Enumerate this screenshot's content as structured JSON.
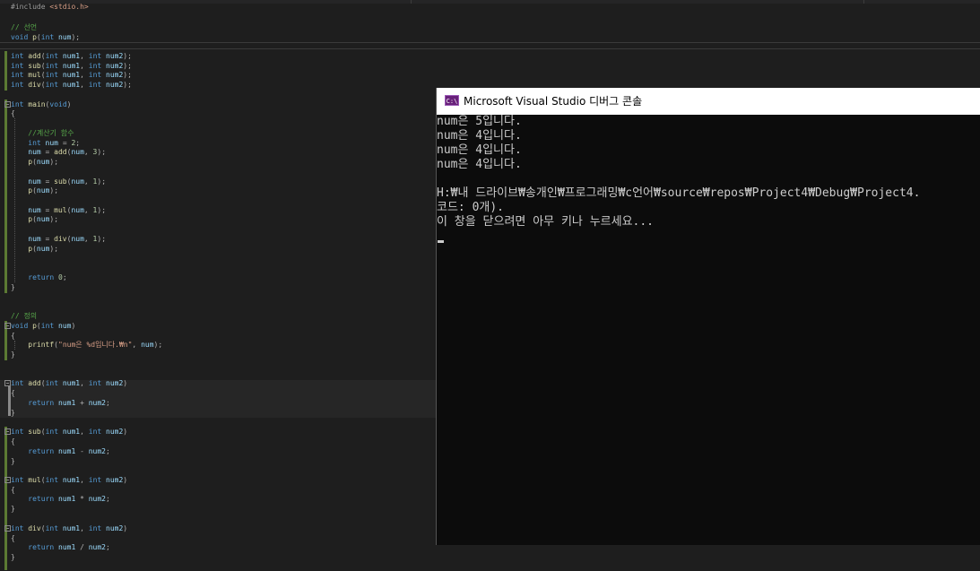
{
  "editor": {
    "lines": [
      {
        "t": 2,
        "tokens": [
          [
            "pp",
            "#include"
          ],
          [
            "pu",
            " "
          ],
          [
            "st",
            "<stdio.h>"
          ]
        ]
      },
      {
        "t": 25,
        "tokens": [
          [
            "cm",
            "// 선언"
          ]
        ]
      },
      {
        "t": 36,
        "tokens": [
          [
            "kw",
            "void"
          ],
          [
            "pu",
            " "
          ],
          [
            "fn",
            "p"
          ],
          [
            "pu",
            "("
          ],
          [
            "kw",
            "int"
          ],
          [
            "pu",
            " "
          ],
          [
            "id",
            "num"
          ],
          [
            "pu",
            ");"
          ]
        ]
      },
      {
        "t": 57,
        "tokens": [
          [
            "kw",
            "int"
          ],
          [
            "pu",
            " "
          ],
          [
            "fn",
            "add"
          ],
          [
            "pu",
            "("
          ],
          [
            "kw",
            "int"
          ],
          [
            "pu",
            " "
          ],
          [
            "id",
            "num1"
          ],
          [
            "pu",
            ", "
          ],
          [
            "kw",
            "int"
          ],
          [
            "pu",
            " "
          ],
          [
            "id",
            "num2"
          ],
          [
            "pu",
            ");"
          ]
        ]
      },
      {
        "t": 68,
        "tokens": [
          [
            "kw",
            "int"
          ],
          [
            "pu",
            " "
          ],
          [
            "fn",
            "sub"
          ],
          [
            "pu",
            "("
          ],
          [
            "kw",
            "int"
          ],
          [
            "pu",
            " "
          ],
          [
            "id",
            "num1"
          ],
          [
            "pu",
            ", "
          ],
          [
            "kw",
            "int"
          ],
          [
            "pu",
            " "
          ],
          [
            "id",
            "num2"
          ],
          [
            "pu",
            ");"
          ]
        ]
      },
      {
        "t": 78,
        "tokens": [
          [
            "kw",
            "int"
          ],
          [
            "pu",
            " "
          ],
          [
            "fn",
            "mul"
          ],
          [
            "pu",
            "("
          ],
          [
            "kw",
            "int"
          ],
          [
            "pu",
            " "
          ],
          [
            "id",
            "num1"
          ],
          [
            "pu",
            ", "
          ],
          [
            "kw",
            "int"
          ],
          [
            "pu",
            " "
          ],
          [
            "id",
            "num2"
          ],
          [
            "pu",
            ");"
          ]
        ]
      },
      {
        "t": 89,
        "tokens": [
          [
            "kw",
            "int"
          ],
          [
            "pu",
            " "
          ],
          [
            "fn",
            "div"
          ],
          [
            "pu",
            "("
          ],
          [
            "kw",
            "int"
          ],
          [
            "pu",
            " "
          ],
          [
            "id",
            "num1"
          ],
          [
            "pu",
            ", "
          ],
          [
            "kw",
            "int"
          ],
          [
            "pu",
            " "
          ],
          [
            "id",
            "num2"
          ],
          [
            "pu",
            ");"
          ]
        ]
      },
      {
        "t": 111,
        "tokens": [
          [
            "kw",
            "int"
          ],
          [
            "pu",
            " "
          ],
          [
            "fn",
            "main"
          ],
          [
            "pu",
            "("
          ],
          [
            "kw",
            "void"
          ],
          [
            "pu",
            ")"
          ]
        ]
      },
      {
        "t": 121,
        "tokens": [
          [
            "pu",
            "{"
          ]
        ]
      },
      {
        "t": 143,
        "tokens": [
          [
            "pu",
            "    "
          ],
          [
            "cm",
            "//계산기 함수"
          ]
        ]
      },
      {
        "t": 154,
        "tokens": [
          [
            "pu",
            "    "
          ],
          [
            "kw",
            "int"
          ],
          [
            "pu",
            " "
          ],
          [
            "id",
            "num"
          ],
          [
            "pu",
            " = "
          ],
          [
            "nm",
            "2"
          ],
          [
            "pu",
            ";"
          ]
        ]
      },
      {
        "t": 164,
        "tokens": [
          [
            "pu",
            "    "
          ],
          [
            "id",
            "num"
          ],
          [
            "pu",
            " = "
          ],
          [
            "fn",
            "add"
          ],
          [
            "pu",
            "("
          ],
          [
            "id",
            "num"
          ],
          [
            "pu",
            ", "
          ],
          [
            "nm",
            "3"
          ],
          [
            "pu",
            ");"
          ]
        ]
      },
      {
        "t": 175,
        "tokens": [
          [
            "pu",
            "    "
          ],
          [
            "fn",
            "p"
          ],
          [
            "pu",
            "("
          ],
          [
            "id",
            "num"
          ],
          [
            "pu",
            ");"
          ]
        ]
      },
      {
        "t": 197,
        "tokens": [
          [
            "pu",
            "    "
          ],
          [
            "id",
            "num"
          ],
          [
            "pu",
            " = "
          ],
          [
            "fn",
            "sub"
          ],
          [
            "pu",
            "("
          ],
          [
            "id",
            "num"
          ],
          [
            "pu",
            ", "
          ],
          [
            "nm",
            "1"
          ],
          [
            "pu",
            ");"
          ]
        ]
      },
      {
        "t": 207,
        "tokens": [
          [
            "pu",
            "    "
          ],
          [
            "fn",
            "p"
          ],
          [
            "pu",
            "("
          ],
          [
            "id",
            "num"
          ],
          [
            "pu",
            ");"
          ]
        ]
      },
      {
        "t": 229,
        "tokens": [
          [
            "pu",
            "    "
          ],
          [
            "id",
            "num"
          ],
          [
            "pu",
            " = "
          ],
          [
            "fn",
            "mul"
          ],
          [
            "pu",
            "("
          ],
          [
            "id",
            "num"
          ],
          [
            "pu",
            ", "
          ],
          [
            "nm",
            "1"
          ],
          [
            "pu",
            ");"
          ]
        ]
      },
      {
        "t": 239,
        "tokens": [
          [
            "pu",
            "    "
          ],
          [
            "fn",
            "p"
          ],
          [
            "pu",
            "("
          ],
          [
            "id",
            "num"
          ],
          [
            "pu",
            ");"
          ]
        ]
      },
      {
        "t": 261,
        "tokens": [
          [
            "pu",
            "    "
          ],
          [
            "id",
            "num"
          ],
          [
            "pu",
            " = "
          ],
          [
            "fn",
            "div"
          ],
          [
            "pu",
            "("
          ],
          [
            "id",
            "num"
          ],
          [
            "pu",
            ", "
          ],
          [
            "nm",
            "1"
          ],
          [
            "pu",
            ");"
          ]
        ]
      },
      {
        "t": 272,
        "tokens": [
          [
            "pu",
            "    "
          ],
          [
            "fn",
            "p"
          ],
          [
            "pu",
            "("
          ],
          [
            "id",
            "num"
          ],
          [
            "pu",
            ");"
          ]
        ]
      },
      {
        "t": 304,
        "tokens": [
          [
            "pu",
            "    "
          ],
          [
            "kw",
            "return"
          ],
          [
            "pu",
            " "
          ],
          [
            "nm",
            "0"
          ],
          [
            "pu",
            ";"
          ]
        ]
      },
      {
        "t": 315,
        "tokens": [
          [
            "pu",
            "}"
          ]
        ]
      },
      {
        "t": 347,
        "tokens": [
          [
            "cm",
            "// 정의"
          ]
        ]
      },
      {
        "t": 358,
        "tokens": [
          [
            "kw",
            "void"
          ],
          [
            "pu",
            " "
          ],
          [
            "fn",
            "p"
          ],
          [
            "pu",
            "("
          ],
          [
            "kw",
            "int"
          ],
          [
            "pu",
            " "
          ],
          [
            "id",
            "num"
          ],
          [
            "pu",
            ")"
          ]
        ]
      },
      {
        "t": 369,
        "tokens": [
          [
            "pu",
            "{"
          ]
        ]
      },
      {
        "t": 379,
        "tokens": [
          [
            "pu",
            "    "
          ],
          [
            "fn",
            "printf"
          ],
          [
            "pu",
            "("
          ],
          [
            "st",
            "\"num은 %d입니다.₩n\""
          ],
          [
            "pu",
            ", "
          ],
          [
            "id",
            "num"
          ],
          [
            "pu",
            ");"
          ]
        ]
      },
      {
        "t": 390,
        "tokens": [
          [
            "pu",
            "}"
          ]
        ]
      },
      {
        "t": 422,
        "tokens": [
          [
            "kw",
            "int"
          ],
          [
            "pu",
            " "
          ],
          [
            "fn",
            "add"
          ],
          [
            "pu",
            "("
          ],
          [
            "kw",
            "int"
          ],
          [
            "pu",
            " "
          ],
          [
            "id",
            "num1"
          ],
          [
            "pu",
            ", "
          ],
          [
            "kw",
            "int"
          ],
          [
            "pu",
            " "
          ],
          [
            "id",
            "num2"
          ],
          [
            "pu",
            ")"
          ]
        ]
      },
      {
        "t": 433,
        "tokens": [
          [
            "pu",
            "{"
          ]
        ]
      },
      {
        "t": 444,
        "tokens": [
          [
            "pu",
            "    "
          ],
          [
            "kw",
            "return"
          ],
          [
            "pu",
            " "
          ],
          [
            "id",
            "num1"
          ],
          [
            "pu",
            " + "
          ],
          [
            "id",
            "num2"
          ],
          [
            "pu",
            ";"
          ]
        ]
      },
      {
        "t": 455,
        "tokens": [
          [
            "pu",
            "}"
          ]
        ]
      },
      {
        "t": 476,
        "tokens": [
          [
            "kw",
            "int"
          ],
          [
            "pu",
            " "
          ],
          [
            "fn",
            "sub"
          ],
          [
            "pu",
            "("
          ],
          [
            "kw",
            "int"
          ],
          [
            "pu",
            " "
          ],
          [
            "id",
            "num1"
          ],
          [
            "pu",
            ", "
          ],
          [
            "kw",
            "int"
          ],
          [
            "pu",
            " "
          ],
          [
            "id",
            "num2"
          ],
          [
            "pu",
            ")"
          ]
        ]
      },
      {
        "t": 487,
        "tokens": [
          [
            "pu",
            "{"
          ]
        ]
      },
      {
        "t": 498,
        "tokens": [
          [
            "pu",
            "    "
          ],
          [
            "kw",
            "return"
          ],
          [
            "pu",
            " "
          ],
          [
            "id",
            "num1"
          ],
          [
            "pu",
            " - "
          ],
          [
            "id",
            "num2"
          ],
          [
            "pu",
            ";"
          ]
        ]
      },
      {
        "t": 509,
        "tokens": [
          [
            "pu",
            "}"
          ]
        ]
      },
      {
        "t": 530,
        "tokens": [
          [
            "kw",
            "int"
          ],
          [
            "pu",
            " "
          ],
          [
            "fn",
            "mul"
          ],
          [
            "pu",
            "("
          ],
          [
            "kw",
            "int"
          ],
          [
            "pu",
            " "
          ],
          [
            "id",
            "num1"
          ],
          [
            "pu",
            ", "
          ],
          [
            "kw",
            "int"
          ],
          [
            "pu",
            " "
          ],
          [
            "id",
            "num2"
          ],
          [
            "pu",
            ")"
          ]
        ]
      },
      {
        "t": 541,
        "tokens": [
          [
            "pu",
            "{"
          ]
        ]
      },
      {
        "t": 551,
        "tokens": [
          [
            "pu",
            "    "
          ],
          [
            "kw",
            "return"
          ],
          [
            "pu",
            " "
          ],
          [
            "id",
            "num1"
          ],
          [
            "pu",
            " * "
          ],
          [
            "id",
            "num2"
          ],
          [
            "pu",
            ";"
          ]
        ]
      },
      {
        "t": 562,
        "tokens": [
          [
            "pu",
            "}"
          ]
        ]
      },
      {
        "t": 584,
        "tokens": [
          [
            "kw",
            "int"
          ],
          [
            "pu",
            " "
          ],
          [
            "fn",
            "div"
          ],
          [
            "pu",
            "("
          ],
          [
            "kw",
            "int"
          ],
          [
            "pu",
            " "
          ],
          [
            "id",
            "num1"
          ],
          [
            "pu",
            ", "
          ],
          [
            "kw",
            "int"
          ],
          [
            "pu",
            " "
          ],
          [
            "id",
            "num2"
          ],
          [
            "pu",
            ")"
          ]
        ]
      },
      {
        "t": 595,
        "tokens": [
          [
            "pu",
            "{"
          ]
        ]
      },
      {
        "t": 605,
        "tokens": [
          [
            "pu",
            "    "
          ],
          [
            "kw",
            "return"
          ],
          [
            "pu",
            " "
          ],
          [
            "id",
            "num1"
          ],
          [
            "pu",
            " / "
          ],
          [
            "id",
            "num2"
          ],
          [
            "pu",
            ";"
          ]
        ]
      },
      {
        "t": 616,
        "tokens": [
          [
            "pu",
            "}"
          ]
        ]
      }
    ]
  },
  "console": {
    "title": "Microsoft Visual Studio 디버그 콘솔",
    "icon_label": "C:\\",
    "icon_name": "console-app-icon",
    "lines": [
      "num은 5입니다.",
      "num은 4입니다.",
      "num은 4입니다.",
      "num은 4입니다.",
      "",
      "H:₩내 드라이브₩송개인₩프로그래밍₩c언어₩source₩repos₩Project4₩Debug₩Project4.",
      "코드: 0개).",
      "이 창을 닫으려면 아무 키나 누르세요..."
    ]
  },
  "colors": {
    "editor_bg": "#1e1e1e",
    "keyword": "#569cd6",
    "function": "#dcdcaa",
    "comment": "#57a64a",
    "string": "#d69d85",
    "number": "#b5cea8",
    "console_bg": "#0c0c0c"
  }
}
